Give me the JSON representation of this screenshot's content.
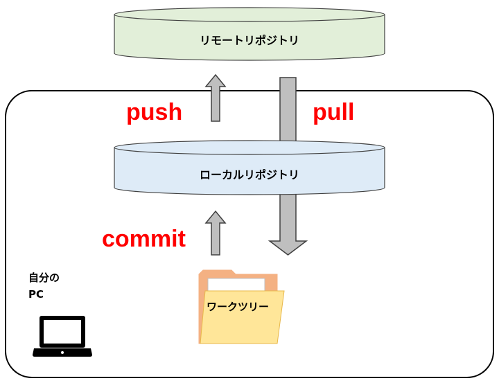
{
  "remote_repo": {
    "label": "リモートリポジトリ",
    "fill": "#e2efd9"
  },
  "local_repo": {
    "label": "ローカルリポジトリ",
    "fill": "#deebf7"
  },
  "commands": {
    "push": "push",
    "pull": "pull",
    "commit": "commit",
    "color": "#ff0000"
  },
  "work_tree": {
    "label": "ワークツリー",
    "fill": "#ffe699",
    "tab_fill": "#f4b183"
  },
  "pc": {
    "line1": "自分の",
    "line2": "PC"
  },
  "arrow_fill": "#bfbfbf"
}
